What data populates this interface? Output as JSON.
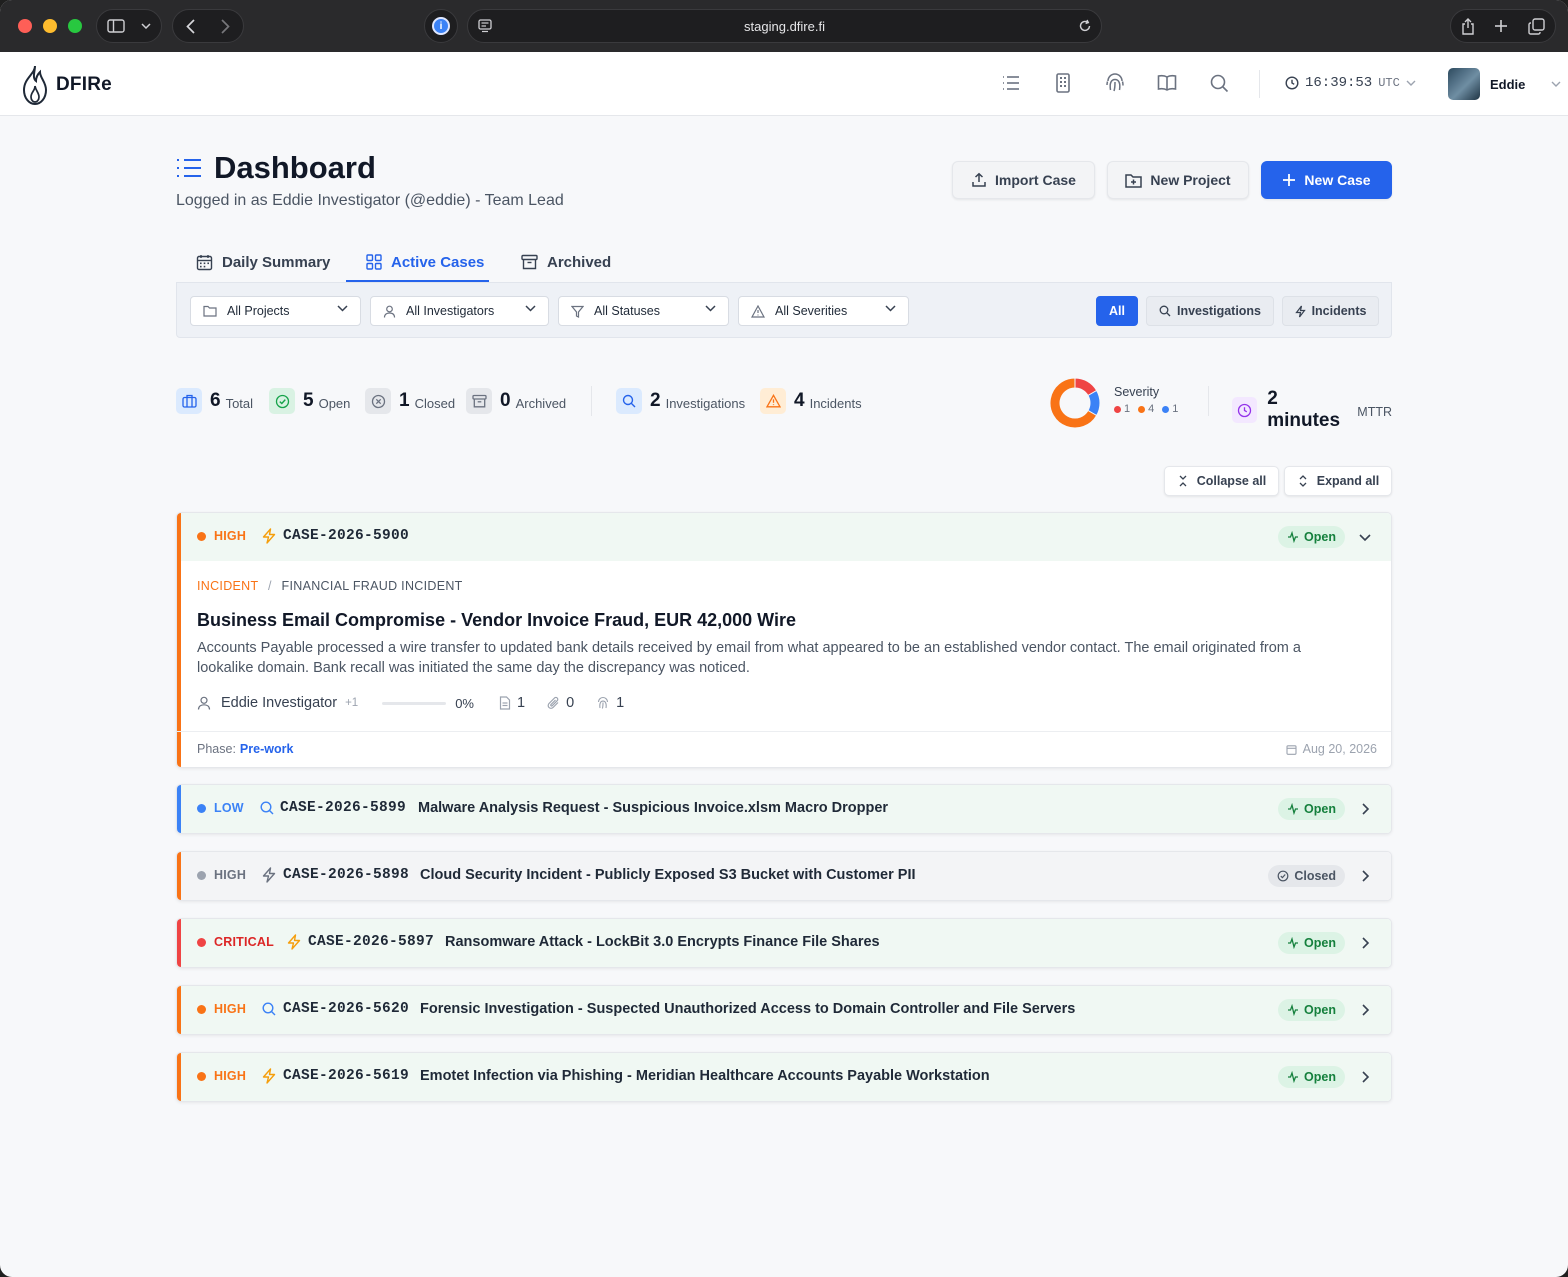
{
  "browser": {
    "url": "staging.dfire.fi"
  },
  "app": {
    "logo_text": "DFIRe",
    "clock_time": "16:39:53",
    "clock_zone": "UTC",
    "user_name": "Eddie"
  },
  "page": {
    "title": "Dashboard",
    "subtitle": "Logged in as Eddie Investigator (@eddie) - Team Lead",
    "buttons": {
      "import": "Import Case",
      "new_project": "New Project",
      "new_case": "New Case"
    }
  },
  "tabs": [
    {
      "label": "Daily Summary",
      "icon": "calendar-icon"
    },
    {
      "label": "Active Cases",
      "icon": "grid-icon",
      "active": true
    },
    {
      "label": "Archived",
      "icon": "archive-icon"
    }
  ],
  "filters": {
    "projects": "All Projects",
    "investigators": "All Investigators",
    "statuses": "All Statuses",
    "severities": "All Severities",
    "type_all": "All",
    "type_investigations": "Investigations",
    "type_incidents": "Incidents"
  },
  "stats": {
    "total": {
      "value": "6",
      "label": "Total"
    },
    "open": {
      "value": "5",
      "label": "Open"
    },
    "closed": {
      "value": "1",
      "label": "Closed"
    },
    "archived": {
      "value": "0",
      "label": "Archived"
    },
    "investigations": {
      "value": "2",
      "label": "Investigations"
    },
    "incidents": {
      "value": "4",
      "label": "Incidents"
    },
    "severity": {
      "label": "Severity",
      "critical": "1",
      "high": "4",
      "low": "1",
      "colors": {
        "critical": "#ef4444",
        "high": "#f97316",
        "low": "#3b82f6"
      }
    },
    "mttr": {
      "value": "2 minutes",
      "label": "MTTR"
    }
  },
  "controls": {
    "collapse_all": "Collapse all",
    "expand_all": "Expand all"
  },
  "colors": {
    "accent": "#2563eb",
    "high": "#f97316",
    "low": "#3b82f6",
    "critical": "#ef4444",
    "closed_sev": "#9ca3af",
    "open_green": "#15803d"
  },
  "cases": [
    {
      "severity": "HIGH",
      "type": "incident",
      "id": "CASE-2026-5900",
      "status": "Open",
      "category_type": "INCIDENT",
      "category_sep": "/",
      "category": "FINANCIAL FRAUD INCIDENT",
      "title": "Business Email Compromise - Vendor Invoice Fraud, EUR 42,000 Wire",
      "description": "Accounts Payable processed a wire transfer to updated bank details received by email from what appeared to be an established vendor contact. The email originated from a lookalike domain. Bank recall was initiated the same day the discrepancy was noticed.",
      "assignee": "Eddie Investigator",
      "assignee_extra": "+1",
      "progress_value": 0,
      "progress": "0%",
      "notes": "1",
      "attachments": "0",
      "evidence": "1",
      "phase_label": "Phase:",
      "phase": "Pre-work",
      "date": "Aug 20, 2026"
    },
    {
      "severity": "LOW",
      "type": "investigation",
      "id": "CASE-2026-5899",
      "title": "Malware Analysis Request - Suspicious Invoice.xlsm Macro Dropper",
      "status": "Open"
    },
    {
      "severity": "HIGH",
      "type": "incident",
      "id": "CASE-2026-5898",
      "title": "Cloud Security Incident - Publicly Exposed S3 Bucket with Customer PII",
      "status": "Closed"
    },
    {
      "severity": "CRITICAL",
      "type": "incident",
      "id": "CASE-2026-5897",
      "title": "Ransomware Attack - LockBit 3.0 Encrypts Finance File Shares",
      "status": "Open"
    },
    {
      "severity": "HIGH",
      "type": "investigation",
      "id": "CASE-2026-5620",
      "title": "Forensic Investigation - Suspected Unauthorized Access to Domain Controller and File Servers",
      "status": "Open"
    },
    {
      "severity": "HIGH",
      "type": "incident",
      "id": "CASE-2026-5619",
      "title": "Emotet Infection via Phishing - Meridian Healthcare Accounts Payable Workstation",
      "status": "Open"
    }
  ]
}
